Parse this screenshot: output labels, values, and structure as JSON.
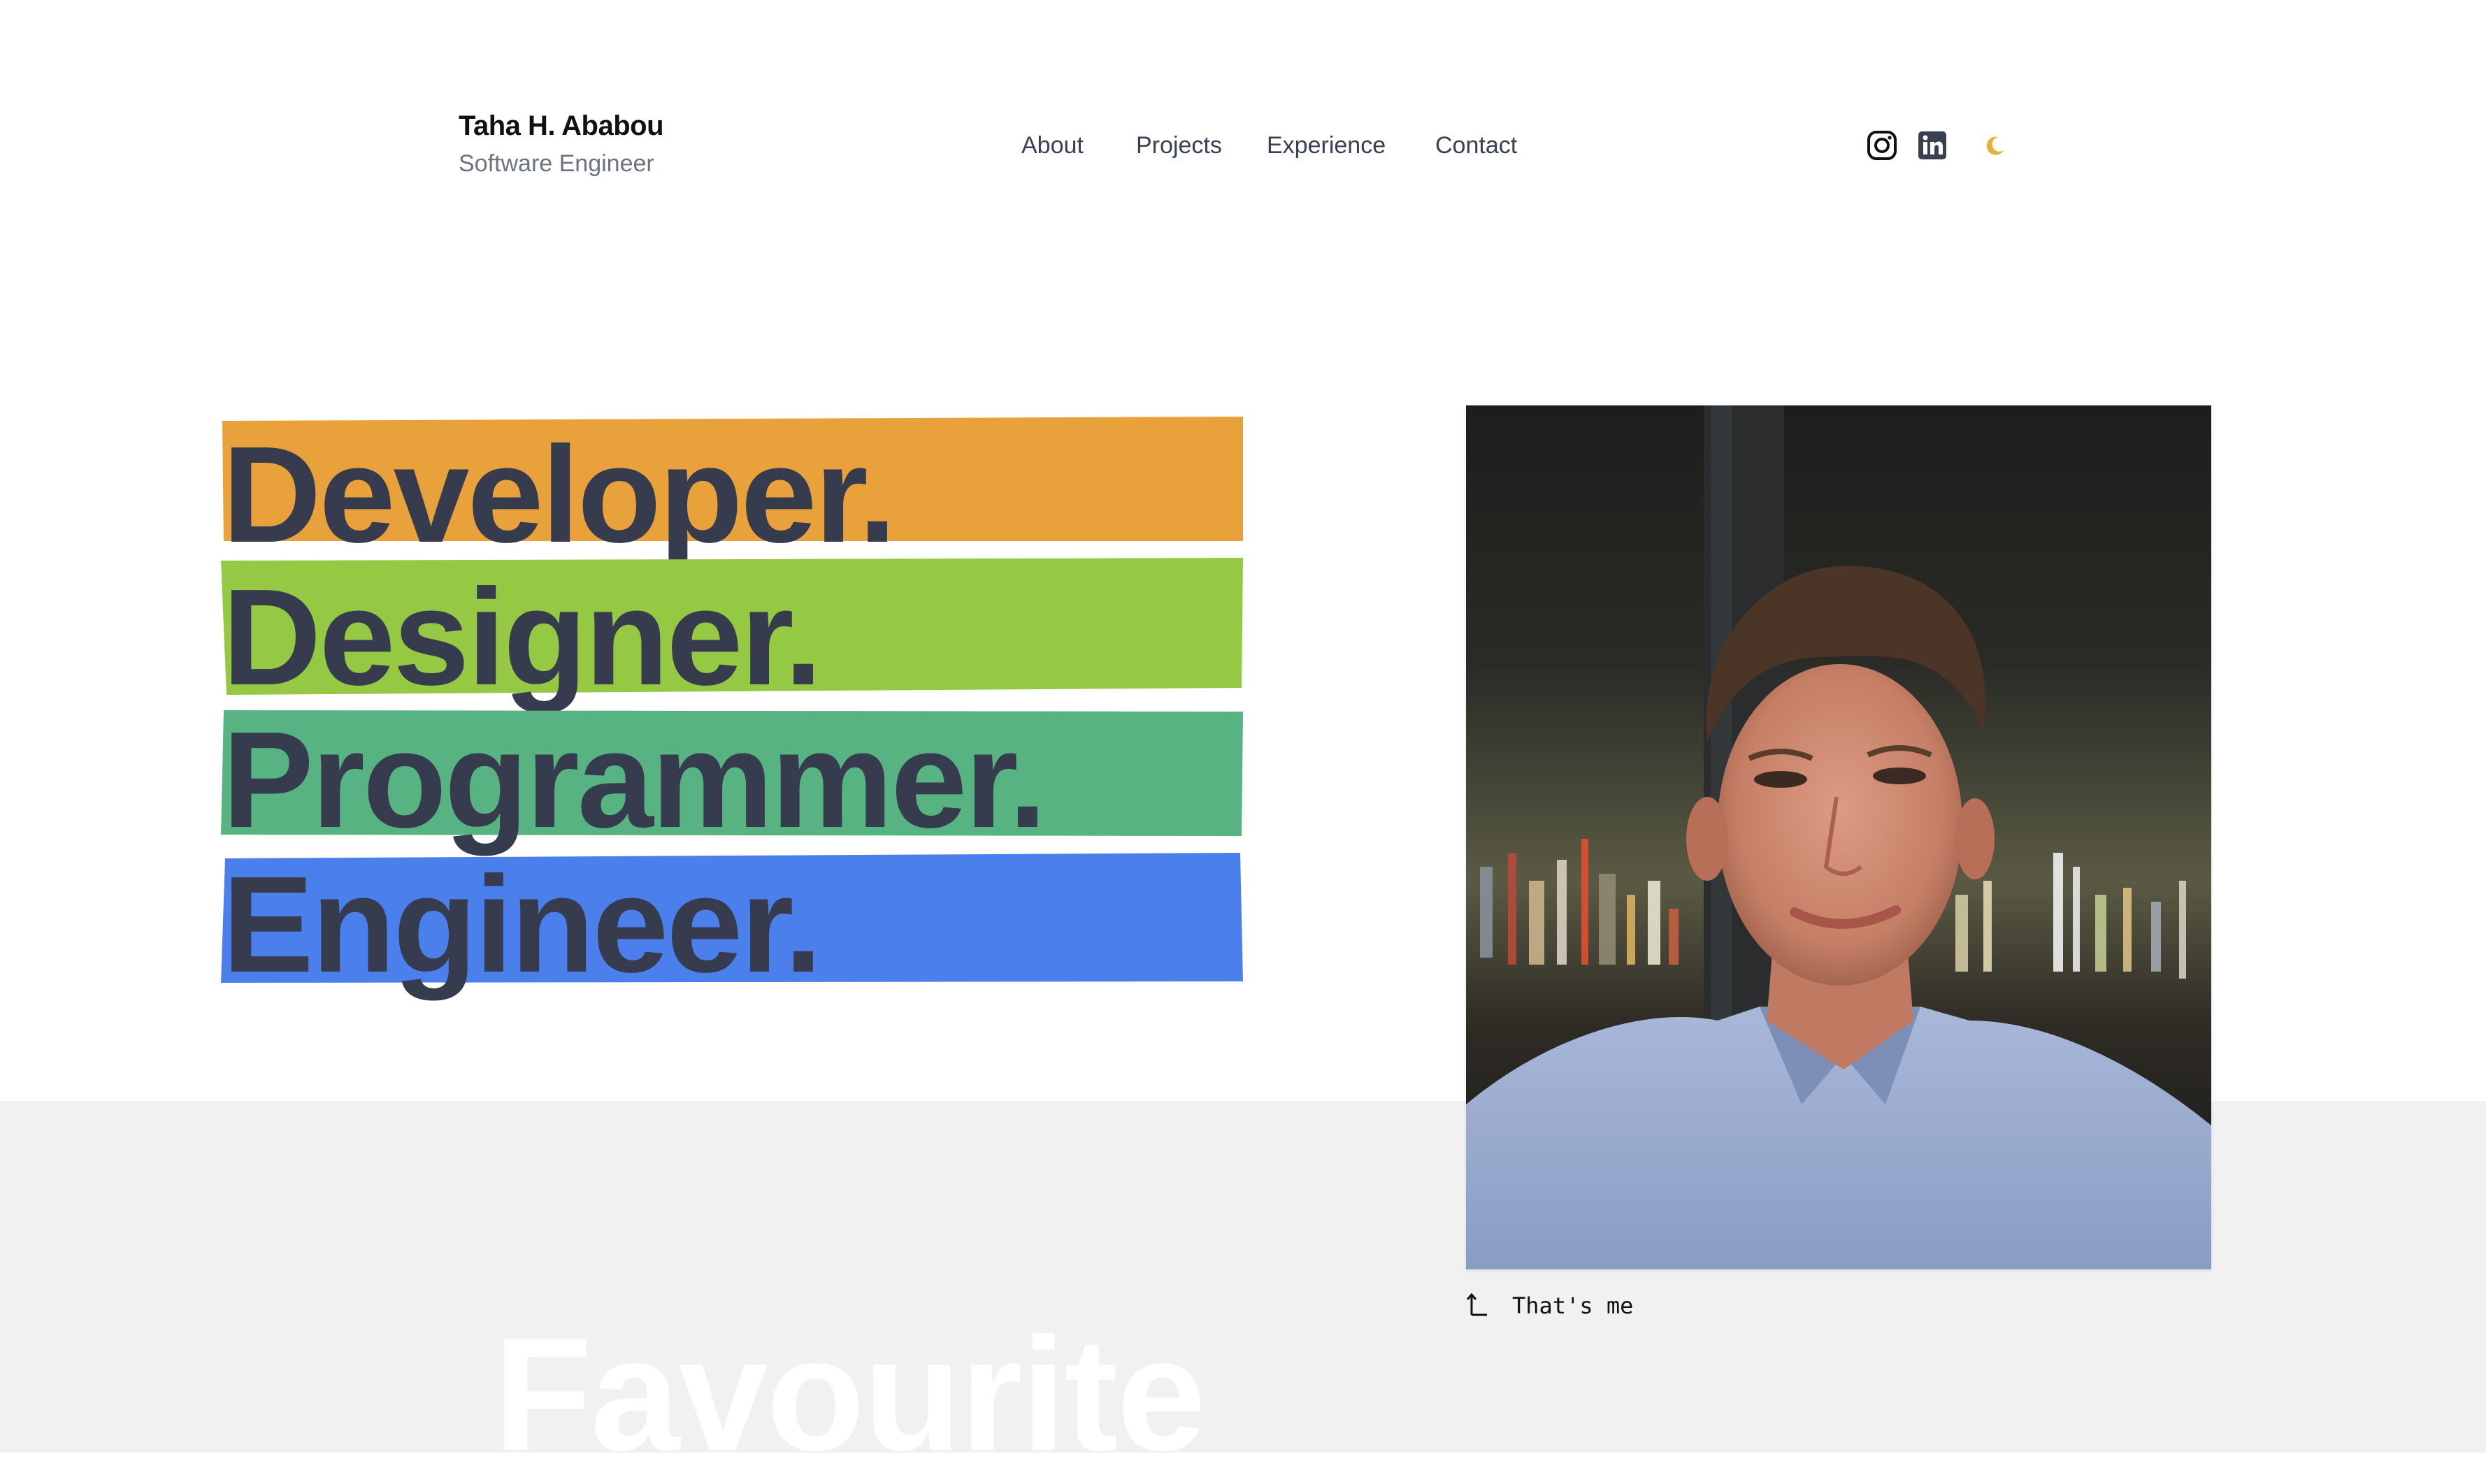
{
  "header": {
    "name": "Taha H. Ababou",
    "role": "Software Engineer",
    "nav": [
      {
        "label": "About"
      },
      {
        "label": "Projects"
      },
      {
        "label": "Experience"
      },
      {
        "label": "Contact"
      }
    ],
    "icons": {
      "instagram": "instagram-icon",
      "linkedin": "linkedin-icon",
      "theme": "moon-icon"
    },
    "theme_icon_color": "#e5b136"
  },
  "hero": {
    "words": [
      {
        "text": "Developer.",
        "color": "#e9a13b"
      },
      {
        "text": "Designer.",
        "color": "#95c944"
      },
      {
        "text": "Programmer.",
        "color": "#57b482"
      },
      {
        "text": "Engineer.",
        "color": "#4b80ec"
      }
    ],
    "text_color": "#363b4e"
  },
  "photo": {
    "caption": "That's me"
  },
  "band": {
    "heading": "Favourite"
  }
}
